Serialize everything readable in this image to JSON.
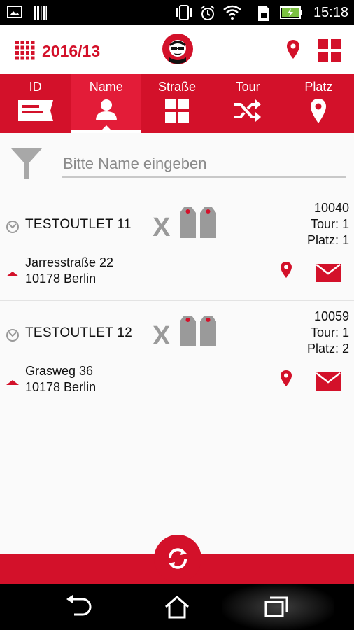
{
  "status_bar": {
    "time": "15:18"
  },
  "header": {
    "title": "2016/13"
  },
  "tabs": [
    {
      "label": "ID",
      "icon": "id-card-icon",
      "active": false
    },
    {
      "label": "Name",
      "icon": "person-icon",
      "active": true
    },
    {
      "label": "Straße",
      "icon": "grid-icon",
      "active": false
    },
    {
      "label": "Tour",
      "icon": "shuffle-icon",
      "active": false
    },
    {
      "label": "Platz",
      "icon": "location-pin-icon",
      "active": false
    }
  ],
  "filter": {
    "placeholder": "Bitte Name eingeben",
    "value": ""
  },
  "items": [
    {
      "name": "TESTOUTLET 11",
      "x_mark": "X",
      "number": "10040",
      "tour": "Tour: 1",
      "platz": "Platz: 1",
      "street": "Jarresstraße 22",
      "city": "10178 Berlin"
    },
    {
      "name": "TESTOUTLET 12",
      "x_mark": "X",
      "number": "10059",
      "tour": "Tour: 1",
      "platz": "Platz: 2",
      "street": "Grasweg 36",
      "city": "10178 Berlin"
    }
  ],
  "colors": {
    "accent": "#d3112a",
    "accent_active": "#e31c38",
    "gray_icon": "#9a9a9a"
  }
}
